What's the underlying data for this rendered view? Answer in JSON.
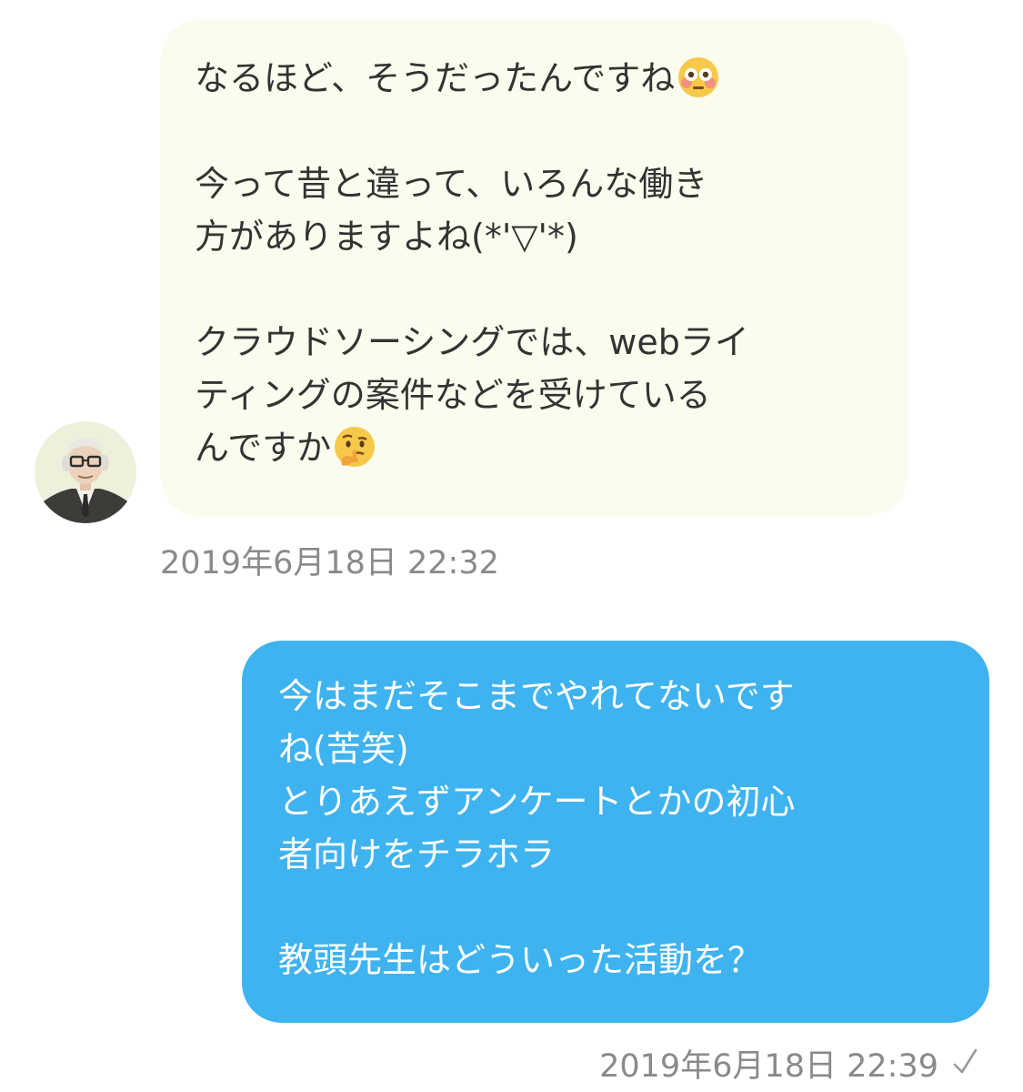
{
  "conversation": {
    "incoming": {
      "avatar_icon": "elderly-man-with-glasses-avatar",
      "bubble_color": "#fbfbee",
      "line1_text": "なるほど、そうだったんですね",
      "line1_emoji": "flushed-face-emoji",
      "para2_line1": "今って昔と違って、いろんな働き",
      "para2_line2": "方がありますよね(*'▽'*)",
      "para3_line1": "クラウドソーシングでは、webライ",
      "para3_line2": "ティングの案件などを受けている",
      "para3_line3": "んですか",
      "para3_emoji": "thinking-face-emoji",
      "timestamp": "2019年6月18日 22:32"
    },
    "outgoing": {
      "bubble_color": "#3fb3ef",
      "line1": "今はまだそこまでやれてないです",
      "line2": "ね(苦笑)",
      "line3": "とりあえずアンケートとかの初心",
      "line4": "者向けをチラホラ",
      "line5": "教頭先生はどういった活動を？",
      "timestamp": "2019年6月18日 22:39",
      "status_icon": "checkmark-sent-icon"
    }
  }
}
